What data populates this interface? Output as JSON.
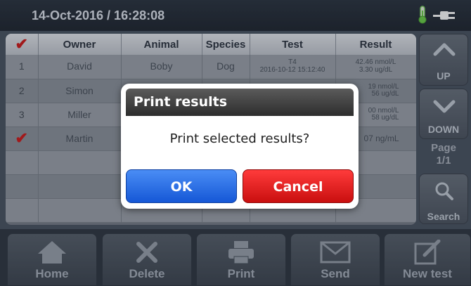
{
  "header": {
    "datetime": "14-Oct-2016 / 16:28:08"
  },
  "table": {
    "columns": [
      "Owner",
      "Animal",
      "Species",
      "Test",
      "Result"
    ],
    "rows": [
      {
        "index": "1",
        "owner": "David",
        "animal": "Boby",
        "species": "Dog",
        "test_name": "T4",
        "test_date": "2016-10-12 15:12:40",
        "result_line1": "42.46 nmol/L",
        "result_line2": "3.30 ug/dL"
      },
      {
        "index": "2",
        "owner": "Simon",
        "result_line1": "19 nmol/L",
        "result_line2": "56 ug/dL"
      },
      {
        "index": "3",
        "owner": "Miller",
        "result_line1": "00 nmol/L",
        "result_line2": "58 ug/dL"
      },
      {
        "index": "",
        "checked": true,
        "owner": "Martin",
        "result_line1": "07 ng/mL"
      }
    ]
  },
  "side": {
    "up_label": "UP",
    "down_label": "DOWN",
    "page_label": "Page",
    "page_value": "1/1",
    "search_label": "Search"
  },
  "toolbar": {
    "home": "Home",
    "delete": "Delete",
    "print": "Print",
    "send": "Send",
    "new_test": "New test"
  },
  "dialog": {
    "title": "Print results",
    "message": "Print selected results?",
    "ok": "OK",
    "cancel": "Cancel"
  },
  "colors": {
    "ok_button": "#1e63e0",
    "cancel_button": "#e01e1e",
    "check_mark": "#d11a1a"
  }
}
